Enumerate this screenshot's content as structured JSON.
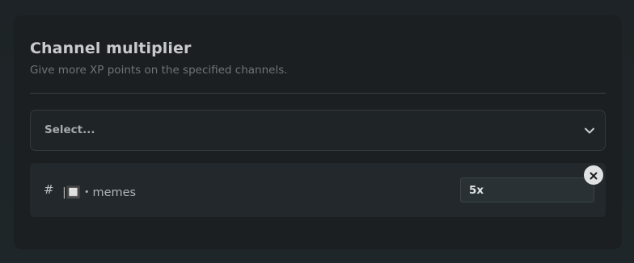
{
  "card": {
    "title": "Channel multiplier",
    "subtitle": "Give more XP points on the specified channels."
  },
  "select": {
    "placeholder": "Select...",
    "icon": "chevron-down-icon"
  },
  "channels": [
    {
      "prefix_icon": "hash-icon",
      "prefix": "#",
      "name": "|🔲・memes",
      "multiplier": "5x",
      "remove_icon": "close-icon"
    }
  ],
  "colors": {
    "background": "#1e2427",
    "card": "#1b1f21",
    "row": "#22282b",
    "remove_button": "#dfe1e2"
  }
}
